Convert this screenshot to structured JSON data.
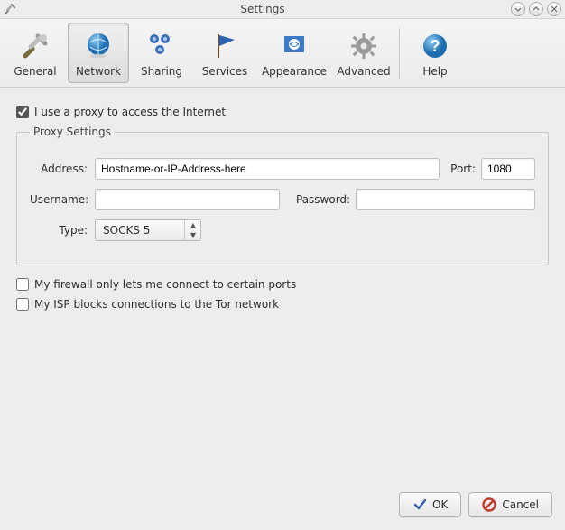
{
  "window": {
    "title": "Settings"
  },
  "toolbar": {
    "items": [
      {
        "id": "general",
        "label": "General"
      },
      {
        "id": "network",
        "label": "Network",
        "active": true
      },
      {
        "id": "sharing",
        "label": "Sharing"
      },
      {
        "id": "services",
        "label": "Services"
      },
      {
        "id": "appearance",
        "label": "Appearance"
      },
      {
        "id": "advanced",
        "label": "Advanced"
      },
      {
        "id": "help",
        "label": "Help"
      }
    ]
  },
  "network": {
    "use_proxy_label": "I use a proxy to access the Internet",
    "use_proxy_checked": true,
    "proxy_group_label": "Proxy Settings",
    "address_label": "Address:",
    "address_value": "Hostname-or-IP-Address-here",
    "port_label": "Port:",
    "port_value": "1080",
    "username_label": "Username:",
    "username_value": "",
    "password_label": "Password:",
    "password_value": "",
    "type_label": "Type:",
    "type_value": "SOCKS 5",
    "firewall_label": "My firewall only lets me connect to certain ports",
    "firewall_checked": false,
    "isp_label": "My ISP blocks connections to the Tor network",
    "isp_checked": false
  },
  "buttons": {
    "ok": "OK",
    "cancel": "Cancel"
  }
}
